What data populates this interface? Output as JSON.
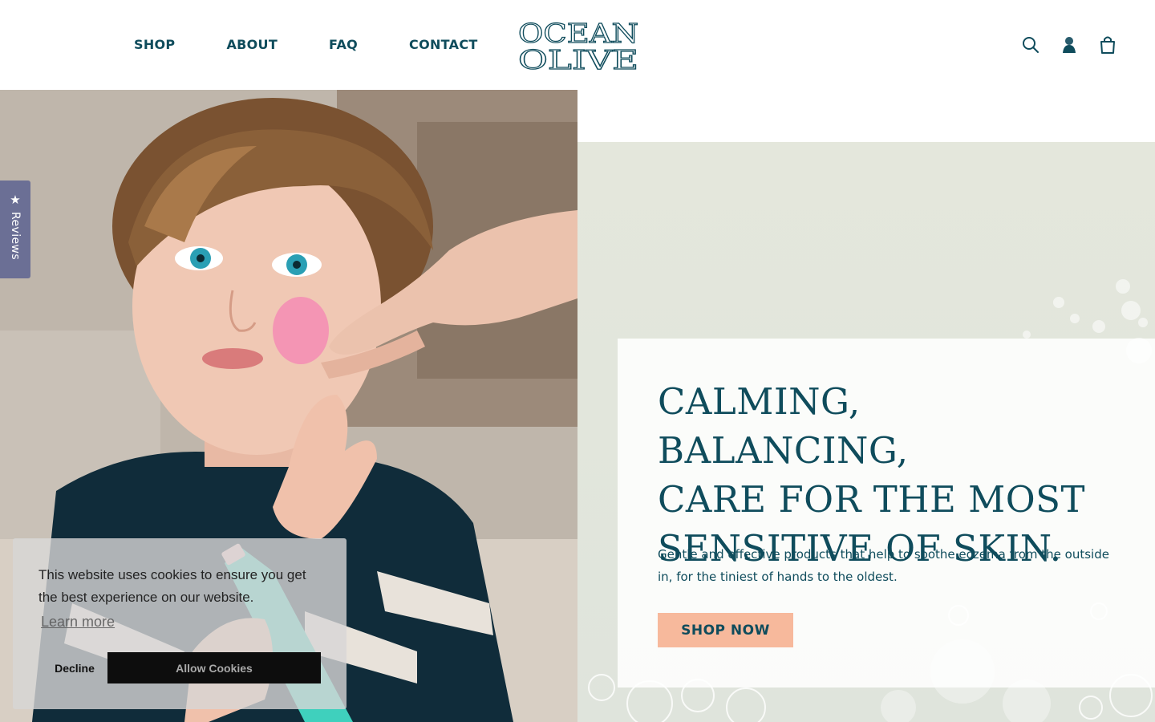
{
  "header": {
    "nav": [
      "SHOP",
      "ABOUT",
      "FAQ",
      "CONTACT"
    ],
    "logo_lines": [
      "OCEAN",
      "OLIVE"
    ],
    "icons": [
      "search-icon",
      "account-icon",
      "cart-icon"
    ]
  },
  "reviews_tab": {
    "star": "★",
    "label": "Reviews"
  },
  "hero": {
    "title": "CALMING, BALANCING,\nCARE FOR THE MOST\nSENSITIVE OF SKIN.",
    "subtitle": "Gentle and effective products that help to soothe eczema from the outside in, for the tiniest of hands to the oldest.",
    "cta": "SHOP NOW"
  },
  "cookie": {
    "message": "This website uses cookies to ensure you get the best experience on our website.",
    "learn_more": "Learn more",
    "decline": "Decline",
    "allow": "Allow Cookies"
  },
  "colors": {
    "brand_teal": "#0f4c5c",
    "cta_peach": "#f7b99c",
    "reviews_tab": "#6b6f95",
    "hero_bg_sage": "#e2e6dc"
  }
}
